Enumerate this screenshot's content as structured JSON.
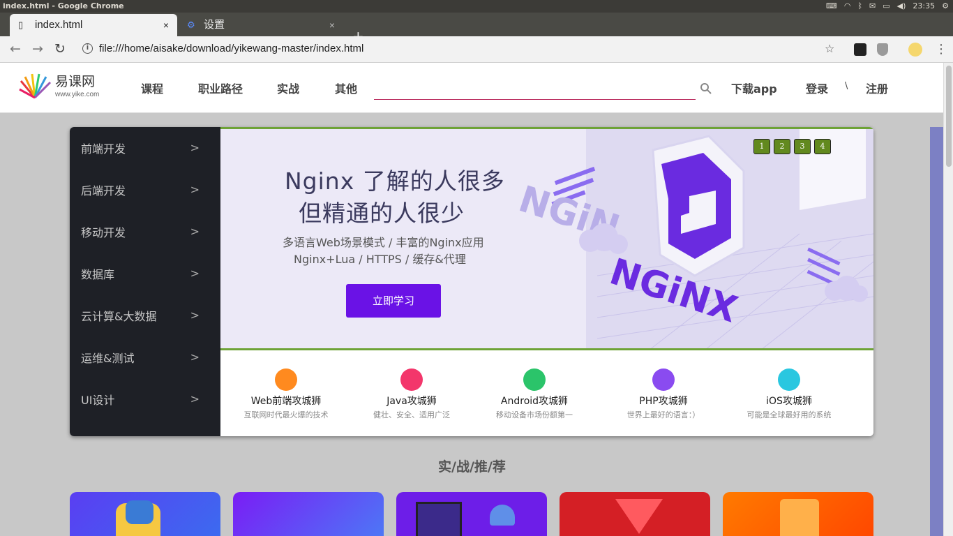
{
  "os": {
    "window_title": "index.html - Google Chrome",
    "clock": "23:35"
  },
  "browser": {
    "tabs": [
      {
        "label": "index.html",
        "active": true
      },
      {
        "label": "设置",
        "active": false
      }
    ],
    "url": "file:///home/aisake/download/yikewang-master/index.html"
  },
  "site": {
    "logo_text": "易课网",
    "logo_sub": "www.yike.com",
    "nav": [
      "课程",
      "职业路径",
      "实战",
      "其他"
    ],
    "search_placeholder": "",
    "download": "下载app",
    "login": "登录",
    "separator": "\\",
    "register": "注册"
  },
  "sidebar": {
    "items": [
      {
        "label": "前端开发"
      },
      {
        "label": "后端开发"
      },
      {
        "label": "移动开发"
      },
      {
        "label": "数据库"
      },
      {
        "label": "云计算&大数据"
      },
      {
        "label": "运维&测试"
      },
      {
        "label": "UI设计"
      }
    ],
    "chevron": ">"
  },
  "banner": {
    "title_line1": "Nginx 了解的人很多",
    "title_line2": "但精通的人很少",
    "sub_line1": "多语言Web场景模式  /  丰富的Nginx应用",
    "sub_line2": "Nginx+Lua  /  HTTPS  /  缓存&代理",
    "cta": "立即学习",
    "art_text": "NGiNX",
    "pager": [
      "1",
      "2",
      "3",
      "4"
    ],
    "colors": {
      "accent": "#6a12e6",
      "border": "#6ea337",
      "pager": "#62891e"
    }
  },
  "categories": [
    {
      "title": "Web前端攻城狮",
      "desc": "互联网时代最火爆的技术",
      "icon": "web-icon",
      "color": "#ff8a1f"
    },
    {
      "title": "Java攻城狮",
      "desc": "健壮、安全、适用广泛",
      "icon": "java-icon",
      "color": "#f3366b"
    },
    {
      "title": "Android攻城狮",
      "desc": "移动设备市场份额第一",
      "icon": "android-icon",
      "color": "#2bc46a"
    },
    {
      "title": "PHP攻城狮",
      "desc": "世界上最好的语言：）",
      "icon": "php-icon",
      "color": "#8a4bf0"
    },
    {
      "title": "iOS攻城狮",
      "desc": "可能是全球最好用的系统",
      "icon": "ios-icon",
      "color": "#29c7e0"
    }
  ],
  "section": {
    "title": "实/战/推/荐"
  }
}
